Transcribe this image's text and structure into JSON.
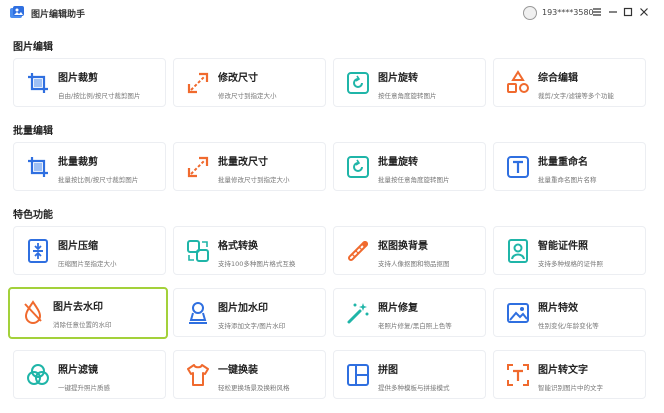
{
  "app": {
    "title": "图片编辑助手",
    "user": "193****3580"
  },
  "sections": [
    {
      "title": "图片编辑"
    },
    {
      "title": "批量编辑"
    },
    {
      "title": "特色功能"
    }
  ],
  "cards": [
    {
      "label": "图片裁剪",
      "desc": "自由/按比例/按尺寸裁剪图片",
      "icon": "crop-icon",
      "color": "#2f6fe0"
    },
    {
      "label": "修改尺寸",
      "desc": "修改尺寸到指定大小",
      "icon": "resize-icon",
      "color": "#f06a2e"
    },
    {
      "label": "图片旋转",
      "desc": "按任意角度旋转图片",
      "icon": "rotate-icon",
      "color": "#1fb5a8"
    },
    {
      "label": "综合编辑",
      "desc": "裁剪/文字/滤镜等多个功能",
      "icon": "shapes-icon",
      "color": "#f06a2e"
    },
    {
      "label": "批量裁剪",
      "desc": "批量按比例/按尺寸裁剪图片",
      "icon": "crop-icon",
      "color": "#2f6fe0"
    },
    {
      "label": "批量改尺寸",
      "desc": "批量修改尺寸到指定大小",
      "icon": "resize-icon",
      "color": "#f06a2e"
    },
    {
      "label": "批量旋转",
      "desc": "批量按任意角度旋转图片",
      "icon": "rotate-icon",
      "color": "#1fb5a8"
    },
    {
      "label": "批量重命名",
      "desc": "批量重命名图片名称",
      "icon": "text-icon",
      "color": "#2f6fe0"
    },
    {
      "label": "图片压缩",
      "desc": "压缩图片至指定大小",
      "icon": "compress-icon",
      "color": "#2f6fe0"
    },
    {
      "label": "格式转换",
      "desc": "支持100多种图片格式互换",
      "icon": "convert-icon",
      "color": "#1fb5a8"
    },
    {
      "label": "抠图换背景",
      "desc": "支持人像抠图和物品抠图",
      "icon": "cutout-icon",
      "color": "#f06a2e"
    },
    {
      "label": "智能证件照",
      "desc": "支持多种规格的证件照",
      "icon": "idphoto-icon",
      "color": "#1fb5a8"
    },
    {
      "label": "图片去水印",
      "desc": "消除任意位置的水印",
      "icon": "remove-watermark-icon",
      "color": "#f06a2e"
    },
    {
      "label": "图片加水印",
      "desc": "支持添加文字/图片水印",
      "icon": "add-watermark-icon",
      "color": "#2f6fe0"
    },
    {
      "label": "照片修复",
      "desc": "老照片修复/黑白照上色等",
      "icon": "magic-wand-icon",
      "color": "#1fb5a8"
    },
    {
      "label": "照片特效",
      "desc": "性别变化/年龄变化等",
      "icon": "effects-icon",
      "color": "#2f6fe0"
    },
    {
      "label": "照片滤镜",
      "desc": "一键提升照片质感",
      "icon": "filter-icon",
      "color": "#1fb5a8"
    },
    {
      "label": "一键换装",
      "desc": "轻松更换场景及换粉风格",
      "icon": "tshirt-icon",
      "color": "#f06a2e"
    },
    {
      "label": "拼图",
      "desc": "提供多种模板与拼接模式",
      "icon": "collage-icon",
      "color": "#2f6fe0"
    },
    {
      "label": "图片转文字",
      "desc": "智能识别图片中的文字",
      "icon": "ocr-icon",
      "color": "#f06a2e"
    }
  ]
}
